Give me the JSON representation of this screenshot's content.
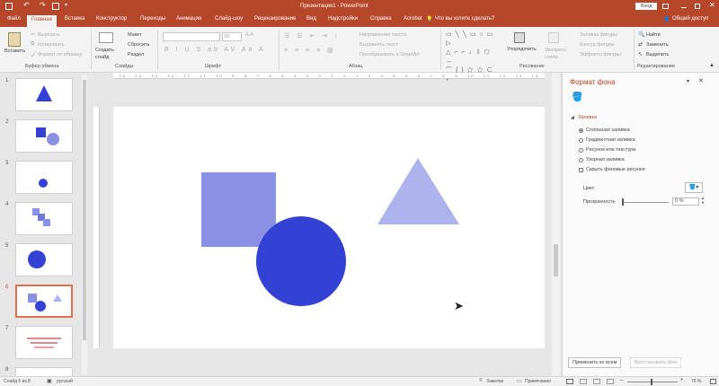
{
  "title": "Презентация1 - PowerPoint",
  "login_label": "Вход",
  "tabs": [
    "Файл",
    "Главная",
    "Вставка",
    "Конструктор",
    "Переходы",
    "Анимация",
    "Слайд-шоу",
    "Рецензирование",
    "Вид",
    "Надстройки",
    "Справка",
    "Acrobat"
  ],
  "tell_me": "Что вы хотите сделать?",
  "share": "Общий доступ",
  "ribbon": {
    "paste": "Вставить",
    "cut": "Вырезать",
    "copy": "Копировать",
    "format_painter": "Формат по образцу",
    "clipboard": "Буфер обмена",
    "new_slide": "Создать слайд",
    "layout": "Макет",
    "reset": "Сбросить",
    "section": "Раздел",
    "slides": "Слайды",
    "font_size": "18",
    "font": "Шрифт",
    "text_direction": "Направление текста",
    "align_text": "Выровнять текст",
    "smartart": "Преобразовать в SmartArt",
    "paragraph": "Абзац",
    "arrange": "Упорядочить",
    "quick_styles": "Экспресс-стили",
    "shape_fill": "Заливка фигуры",
    "shape_outline": "Контур фигуры",
    "shape_effects": "Эффекты фигуры",
    "drawing": "Рисование",
    "find": "Найти",
    "replace": "Заменить",
    "select": "Выделить",
    "editing": "Редактирование"
  },
  "slides": [
    {
      "n": "1"
    },
    {
      "n": "2"
    },
    {
      "n": "3"
    },
    {
      "n": "4"
    },
    {
      "n": "5"
    },
    {
      "n": "6"
    },
    {
      "n": "7"
    },
    {
      "n": "8"
    }
  ],
  "pane": {
    "title": "Формат фона",
    "fill_section": "Заливка",
    "options": [
      "Сплошная заливка",
      "Градиентная заливка",
      "Рисунок или текстура",
      "Узорная заливка"
    ],
    "hide_bg": "Скрыть фоновые рисунки",
    "color_label": "Цвет",
    "transparency_label": "Прозрачность",
    "transparency_value": "0 %",
    "apply_all": "Применить ко всем",
    "reset_bg": "Восстановить фон"
  },
  "status": {
    "slide_info": "Слайд 6 из 8",
    "language": "русский",
    "notes": "Заметки",
    "comments": "Примечания",
    "zoom": "76 %"
  },
  "colors": {
    "accent": "#b7472a",
    "shape_dark": "#3342d4",
    "shape_mid": "#8a91e4",
    "shape_light": "#adb3ec"
  }
}
